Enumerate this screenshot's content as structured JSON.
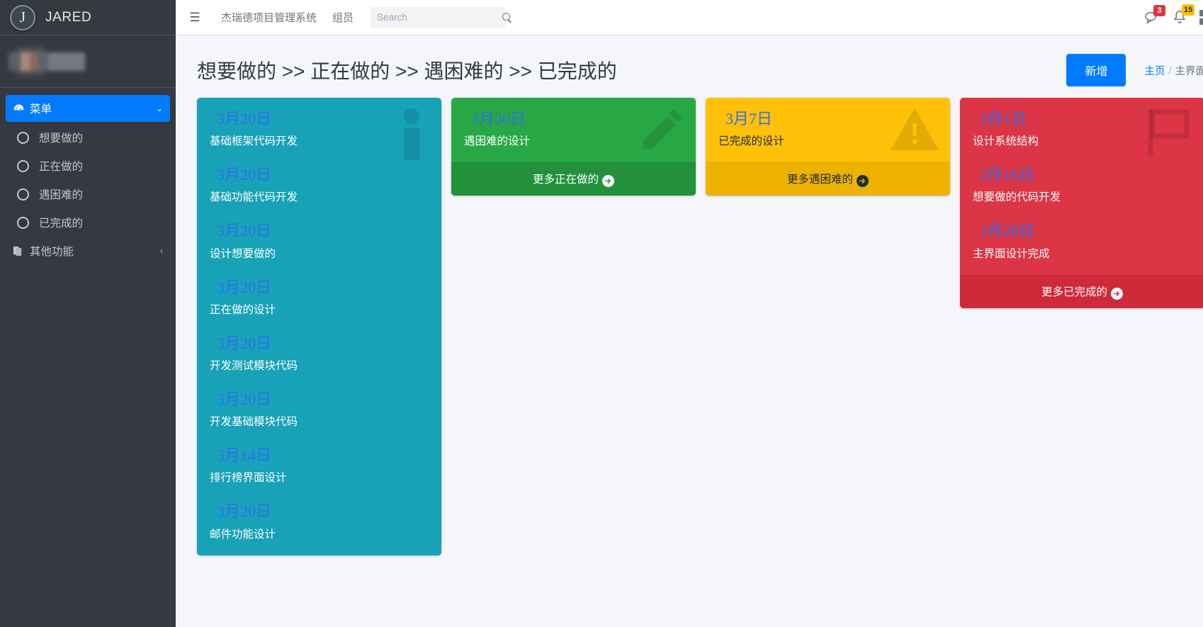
{
  "sidebar": {
    "brand": {
      "logo_letter": "J",
      "title": "JARED"
    },
    "user_redacted": "",
    "menu": {
      "label": "菜单",
      "icon": "dashboard-icon",
      "chevron": "⌄"
    },
    "items": [
      {
        "label": "想要做的"
      },
      {
        "label": "正在做的"
      },
      {
        "label": "遇困难的"
      },
      {
        "label": "已完成的"
      }
    ],
    "other": {
      "label": "其他功能",
      "chevron": "‹"
    }
  },
  "topbar": {
    "hamburger": "☰",
    "links": [
      {
        "label": "杰瑞德项目管理系统"
      },
      {
        "label": "组员"
      }
    ],
    "search": {
      "value": "",
      "placeholder": "Search"
    },
    "messages_badge": "3",
    "notifications_badge": "15"
  },
  "content": {
    "page_title": "想要做的 >> 正在做的 >> 遇困难的 >> 已完成的",
    "add_button": "新增",
    "breadcrumb": {
      "home": "主页",
      "sep": "/",
      "current": "主界面"
    }
  },
  "colors": {
    "cyan": "#17a2b8",
    "green": "#28a745",
    "yellow": "#ffc107",
    "red": "#dc3545",
    "primary": "#007bff",
    "date": "#2f6fed"
  },
  "cards": [
    {
      "color": "cyan",
      "icon": "info-icon",
      "entries": [
        {
          "date": "3月20日",
          "text": "基础框架代码开发"
        },
        {
          "date": "3月20日",
          "text": "基础功能代码开发"
        },
        {
          "date": "3月20日",
          "text": "设计想要做的"
        },
        {
          "date": "3月20日",
          "text": "正在做的设计"
        },
        {
          "date": "3月20日",
          "text": "开发测试模块代码"
        },
        {
          "date": "3月20日",
          "text": "开发基础模块代码"
        },
        {
          "date": "3月14日",
          "text": "排行榜界面设计"
        },
        {
          "date": "3月20日",
          "text": "邮件功能设计"
        }
      ],
      "footer": ""
    },
    {
      "color": "green",
      "icon": "pencil-icon",
      "entries": [
        {
          "date": "3月20日",
          "text": "遇困难的设计"
        }
      ],
      "footer": "更多正在做的"
    },
    {
      "color": "yellow",
      "icon": "warning-icon",
      "entries": [
        {
          "date": "3月7日",
          "text": "已完成的设计"
        }
      ],
      "footer": "更多遇困难的"
    },
    {
      "color": "red",
      "icon": "flag-icon",
      "entries": [
        {
          "date": "3月1日",
          "text": "设计系统结构"
        },
        {
          "date": "2月16日",
          "text": "想要做的代码开发"
        },
        {
          "date": "1月28日",
          "text": "主界面设计完成"
        }
      ],
      "footer": "更多已完成的"
    }
  ]
}
